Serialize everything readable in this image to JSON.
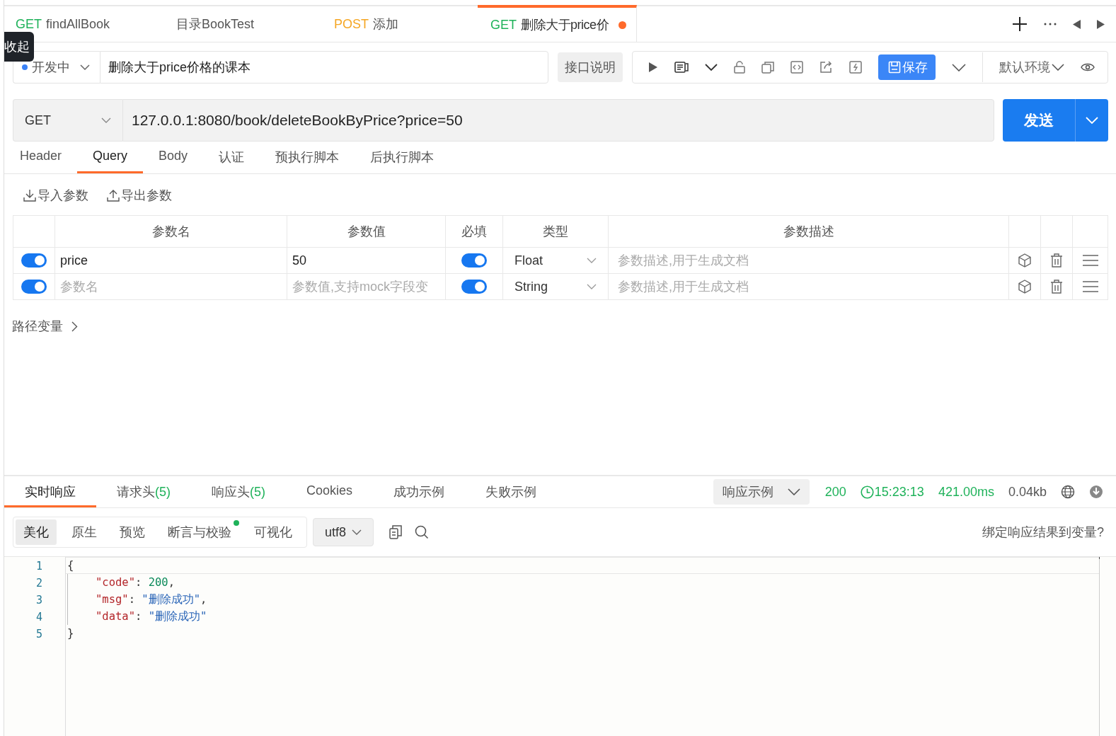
{
  "tabs": [
    {
      "kind": "get",
      "method": "GET",
      "title": "findAllBook",
      "selected": false,
      "modified": false
    },
    {
      "kind": "folder",
      "title": "目录BookTest",
      "selected": false,
      "modified": false
    },
    {
      "kind": "post",
      "method": "POST",
      "title": "添加",
      "selected": false,
      "modified": false
    },
    {
      "kind": "get",
      "method": "GET",
      "title": "删除大于price价",
      "selected": true,
      "modified": true
    }
  ],
  "tooltip": {
    "text": "收起"
  },
  "toolbar": {
    "status": {
      "label": "开发中",
      "color": "#3b82f6"
    },
    "name": {
      "value": "删除大于price价格的课本"
    },
    "doc_button": "接口说明",
    "save_button": "保存",
    "environment": "默认环境"
  },
  "request": {
    "method": "GET",
    "url": "127.0.0.1:8080/book/deleteBookByPrice?price=50",
    "send_button": "发送"
  },
  "request_tabs": [
    {
      "label": "Header",
      "selected": false
    },
    {
      "label": "Query",
      "selected": true
    },
    {
      "label": "Body",
      "selected": false
    },
    {
      "label": "认证",
      "selected": false
    },
    {
      "label": "预执行脚本",
      "selected": false
    },
    {
      "label": "后执行脚本",
      "selected": false
    }
  ],
  "param_actions": [
    {
      "kind": "import",
      "label": "导入参数"
    },
    {
      "kind": "export",
      "label": "导出参数"
    }
  ],
  "params": {
    "columns": [
      "参数名",
      "参数值",
      "必填",
      "类型",
      "参数描述"
    ],
    "rows": [
      {
        "enabled": true,
        "name": {
          "value": "price"
        },
        "value": {
          "value": "50"
        },
        "required": true,
        "type": "Float",
        "description": {
          "placeholder": "参数描述,用于生成文档"
        }
      },
      {
        "enabled": true,
        "name": {
          "placeholder": "参数名"
        },
        "value": {
          "placeholder": "参数值,支持mock字段变"
        },
        "required": true,
        "type": "String",
        "description": {
          "placeholder": "参数描述,用于生成文档"
        }
      }
    ]
  },
  "path_variables": {
    "label": "路径变量",
    "expanded": false
  },
  "response_tabs": [
    {
      "label": "实时响应",
      "selected": true
    },
    {
      "label": "请求头",
      "count": "(5)",
      "selected": false
    },
    {
      "label": "响应头",
      "count": "(5)",
      "selected": false
    },
    {
      "label": "Cookies",
      "selected": false
    },
    {
      "label": "成功示例",
      "selected": false
    },
    {
      "label": "失败示例",
      "selected": false
    }
  ],
  "response_meta": {
    "example_select": "响应示例",
    "status": "200",
    "time": "15:23:13",
    "duration": "421.00ms",
    "size": "0.04kb"
  },
  "view_tabs": [
    {
      "label": "美化",
      "selected": true,
      "dot": false
    },
    {
      "label": "原生",
      "selected": false,
      "dot": false
    },
    {
      "label": "预览",
      "selected": false,
      "dot": false
    },
    {
      "label": "断言与校验",
      "selected": false,
      "dot": true
    },
    {
      "label": "可视化",
      "selected": false,
      "dot": false
    }
  ],
  "encoding": "utf8",
  "bind_link": "绑定响应结果到变量?",
  "code": [
    {
      "number": "1",
      "indent": false,
      "tokens": [
        {
          "kind": "punct",
          "text": "{"
        }
      ]
    },
    {
      "number": "2",
      "indent": true,
      "tokens": [
        {
          "kind": "key",
          "text": "\"code\""
        },
        {
          "kind": "punct",
          "text": ": "
        },
        {
          "kind": "number",
          "text": "200"
        },
        {
          "kind": "punct",
          "text": ","
        }
      ]
    },
    {
      "number": "3",
      "indent": true,
      "tokens": [
        {
          "kind": "key",
          "text": "\"msg\""
        },
        {
          "kind": "punct",
          "text": ": "
        },
        {
          "kind": "string",
          "text": "\"删除成功\""
        },
        {
          "kind": "punct",
          "text": ","
        }
      ]
    },
    {
      "number": "4",
      "indent": true,
      "tokens": [
        {
          "kind": "key",
          "text": "\"data\""
        },
        {
          "kind": "punct",
          "text": ": "
        },
        {
          "kind": "string",
          "text": "\"删除成功\""
        }
      ]
    },
    {
      "number": "5",
      "indent": false,
      "tokens": [
        {
          "kind": "punct",
          "text": "}"
        }
      ]
    }
  ]
}
